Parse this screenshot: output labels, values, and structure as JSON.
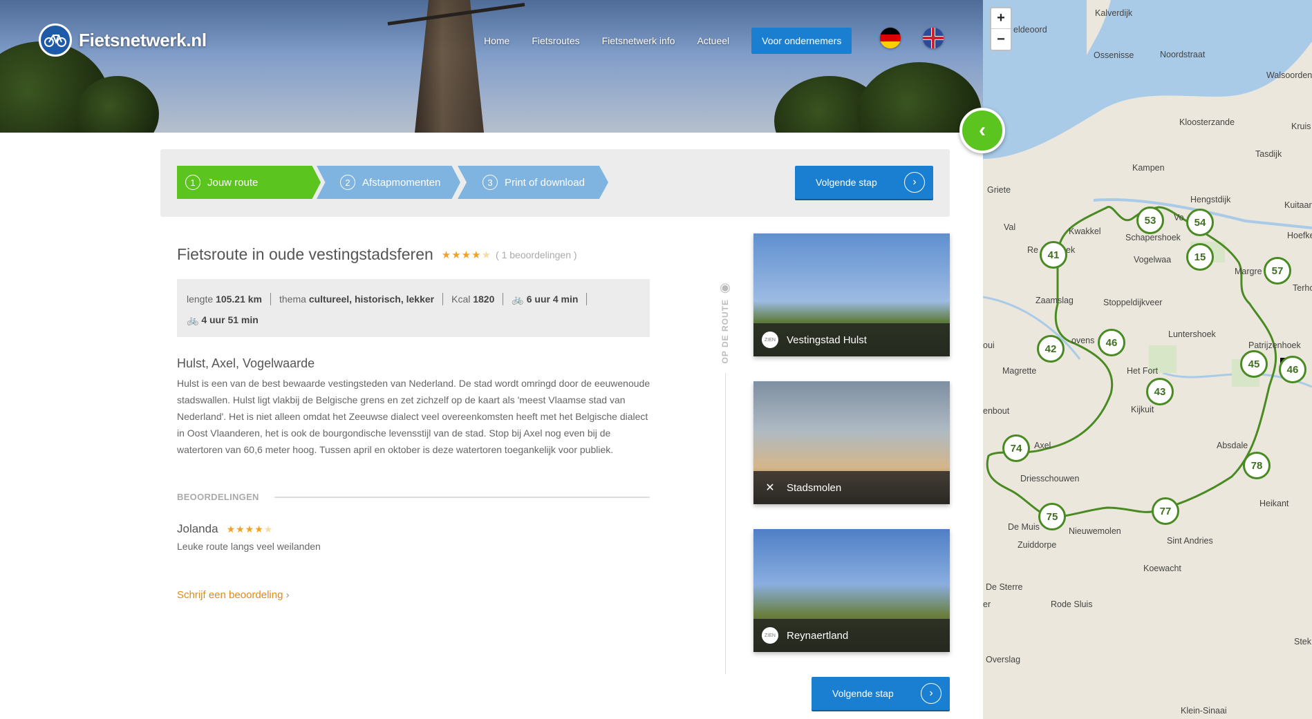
{
  "header": {
    "logo_text": "Fietsnetwerk.nl",
    "nav": [
      "Home",
      "Fietsroutes",
      "Fietsnetwerk info",
      "Actueel"
    ],
    "cta": "Voor ondernemers"
  },
  "steps": [
    {
      "num": "1",
      "label": "Jouw route",
      "active": true
    },
    {
      "num": "2",
      "label": "Afstapmomenten",
      "active": false
    },
    {
      "num": "3",
      "label": "Print of download",
      "active": false
    }
  ],
  "next_button": "Volgende stap",
  "route": {
    "title": "Fietsroute in oude vestingstadsferen",
    "stars": 4,
    "rating_count": "( 1 beoordelingen )",
    "stats": {
      "length_label": "lengte",
      "length_value": "105.21 km",
      "theme_label": "thema",
      "theme_value": "cultureel, historisch, lekker",
      "kcal_label": "Kcal",
      "kcal_value": "1820",
      "bike_time": "6 uur 4 min",
      "ebike_time": "4 uur 51 min"
    },
    "place_title": "Hulst, Axel, Vogelwaarde",
    "description": "Hulst is een van de best bewaarde vestingsteden van Nederland. De stad wordt omringd door de eeuwenoude stadswallen. Hulst ligt vlakbij de Belgische grens en zet zichzelf op de kaart als 'meest Vlaamse stad van Nederland'. Het is niet alleen omdat het Zeeuwse dialect veel overeenkomsten heeft met het Belgische dialect in Oost Vlaanderen, het is ook de bourgondische levensstijl van de stad. Stop bij Axel nog even bij de watertoren van 60,6 meter hoog. Tussen april en oktober is deze watertoren toegankelijk voor publiek."
  },
  "reviews": {
    "heading": "BEOORDELINGEN",
    "items": [
      {
        "name": "Jolanda",
        "stars": 4,
        "text": "Leuke route langs veel weilanden"
      }
    ],
    "write_link": "Schrijf een beoordeling"
  },
  "side_label": "OP DE ROUTE",
  "cards": [
    {
      "title": "Vestingstad Hulst",
      "icon": "zien-badge",
      "badge": "ZIEN"
    },
    {
      "title": "Stadsmolen",
      "icon": "windmill-icon",
      "badge": ""
    },
    {
      "title": "Reynaertland",
      "icon": "zien-badge",
      "badge": "ZIEN"
    }
  ],
  "map": {
    "zoom_in": "+",
    "zoom_out": "−",
    "places": [
      "Kalverdijk",
      "eldeoord",
      "Ossenisse",
      "Noordstraat",
      "Walsoorden",
      "Kloosterzande",
      "Kruis",
      "Tasdijk",
      "Kampen",
      "Griete",
      "Hengstdijk",
      "Kuitaar",
      "Val",
      "Kwakkel",
      "Schapershoek",
      "Hoefkes",
      "Re",
      "ek",
      "Vogelwaa",
      "Margre",
      "Terho",
      "Zaamslag",
      "Stoppeldijkveer",
      "Luntershoek",
      "Patrijzenhoek",
      "oui",
      "ovens",
      "Magrette",
      "Het Fort",
      "enbout",
      "Kijkuit",
      "Absdale",
      "Axel",
      "Driesschouwen",
      "Heikant",
      "De Muis",
      "Nieuwemolen",
      "Zuiddorpe",
      "Sint Andries",
      "Koewacht",
      "De Sterre",
      "Rode Sluis",
      "Overslag",
      "Stek",
      "Klein-Sinaai",
      "Vo",
      "er"
    ],
    "nodes": [
      "41",
      "53",
      "54",
      "15",
      "57",
      "42",
      "46",
      "43",
      "45",
      "46",
      "74",
      "78",
      "75",
      "77"
    ]
  },
  "colors": {
    "accent_green": "#5cc41e",
    "primary_blue": "#1a7fd1",
    "step_blue": "#7fb4e0",
    "star_orange": "#f2a125",
    "link_orange": "#e08a1a",
    "route_green": "#4a8a22"
  }
}
